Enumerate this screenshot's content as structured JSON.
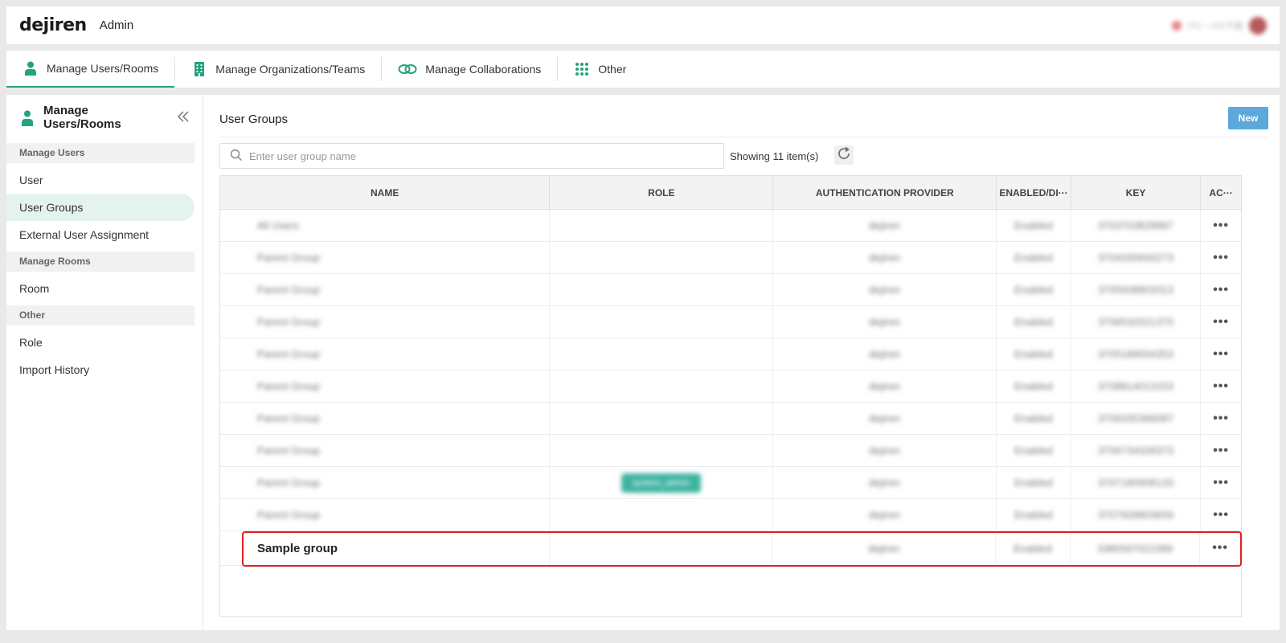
{
  "header": {
    "logo": "dejiren",
    "app_title": "Admin",
    "user_text": "ITC・ITS下請"
  },
  "main_tabs": [
    {
      "label": "Manage Users/Rooms",
      "icon": "person-icon",
      "active": true
    },
    {
      "label": "Manage Organizations/Teams",
      "icon": "building-icon",
      "active": false
    },
    {
      "label": "Manage Collaborations",
      "icon": "link-icon",
      "active": false
    },
    {
      "label": "Other",
      "icon": "grid-dots-icon",
      "active": false
    }
  ],
  "sidebar": {
    "title": "Manage Users/Rooms",
    "sections": [
      {
        "label": "Manage Users",
        "items": [
          "User",
          "User Groups",
          "External User Assignment"
        ]
      },
      {
        "label": "Manage Rooms",
        "items": [
          "Room"
        ]
      },
      {
        "label": "Other",
        "items": [
          "Role",
          "Import History"
        ]
      }
    ],
    "active_item": "User Groups"
  },
  "content": {
    "title": "User Groups",
    "new_label": "New",
    "search_placeholder": "Enter user group name",
    "count_text": "Showing 11 item(s)"
  },
  "table": {
    "columns": [
      "NAME",
      "ROLE",
      "AUTHENTICATION PROVIDER",
      "ENABLED/DI···",
      "KEY",
      "AC···"
    ],
    "rows": [
      {
        "name": "All Users",
        "role": "",
        "auth": "dejiren",
        "enabled": "Enabled",
        "key": "3703703828887"
      },
      {
        "name": "Parent Group",
        "role": "",
        "auth": "dejiren",
        "enabled": "Enabled",
        "key": "3704335600273"
      },
      {
        "name": "Parent Group",
        "role": "",
        "auth": "dejiren",
        "enabled": "Enabled",
        "key": "3705508802013"
      },
      {
        "name": "Parent Group",
        "role": "",
        "auth": "dejiren",
        "enabled": "Enabled",
        "key": "3706532021370"
      },
      {
        "name": "Parent Group",
        "role": "",
        "auth": "dejiren",
        "enabled": "Enabled",
        "key": "3705189504353"
      },
      {
        "name": "Parent Group",
        "role": "",
        "auth": "dejiren",
        "enabled": "Enabled",
        "key": "3708814013153"
      },
      {
        "name": "Parent Group",
        "role": "",
        "auth": "dejiren",
        "enabled": "Enabled",
        "key": "3706335366087"
      },
      {
        "name": "Parent Group",
        "role": "",
        "auth": "dejiren",
        "enabled": "Enabled",
        "key": "3706734328373"
      },
      {
        "name": "Parent Group",
        "role": "system_admin",
        "auth": "dejiren",
        "enabled": "Enabled",
        "key": "3707180908133"
      },
      {
        "name": "Parent Group",
        "role": "",
        "auth": "dejiren",
        "enabled": "Enabled",
        "key": "3707928803659"
      },
      {
        "name": "Sample group",
        "role": "",
        "auth": "dejiren",
        "enabled": "Enabled",
        "key": "3380597021589"
      }
    ],
    "more_label": "•••"
  },
  "colors": {
    "accent": "#23a37e",
    "highlight": "#e02020",
    "new_button": "#5aa8dc"
  }
}
